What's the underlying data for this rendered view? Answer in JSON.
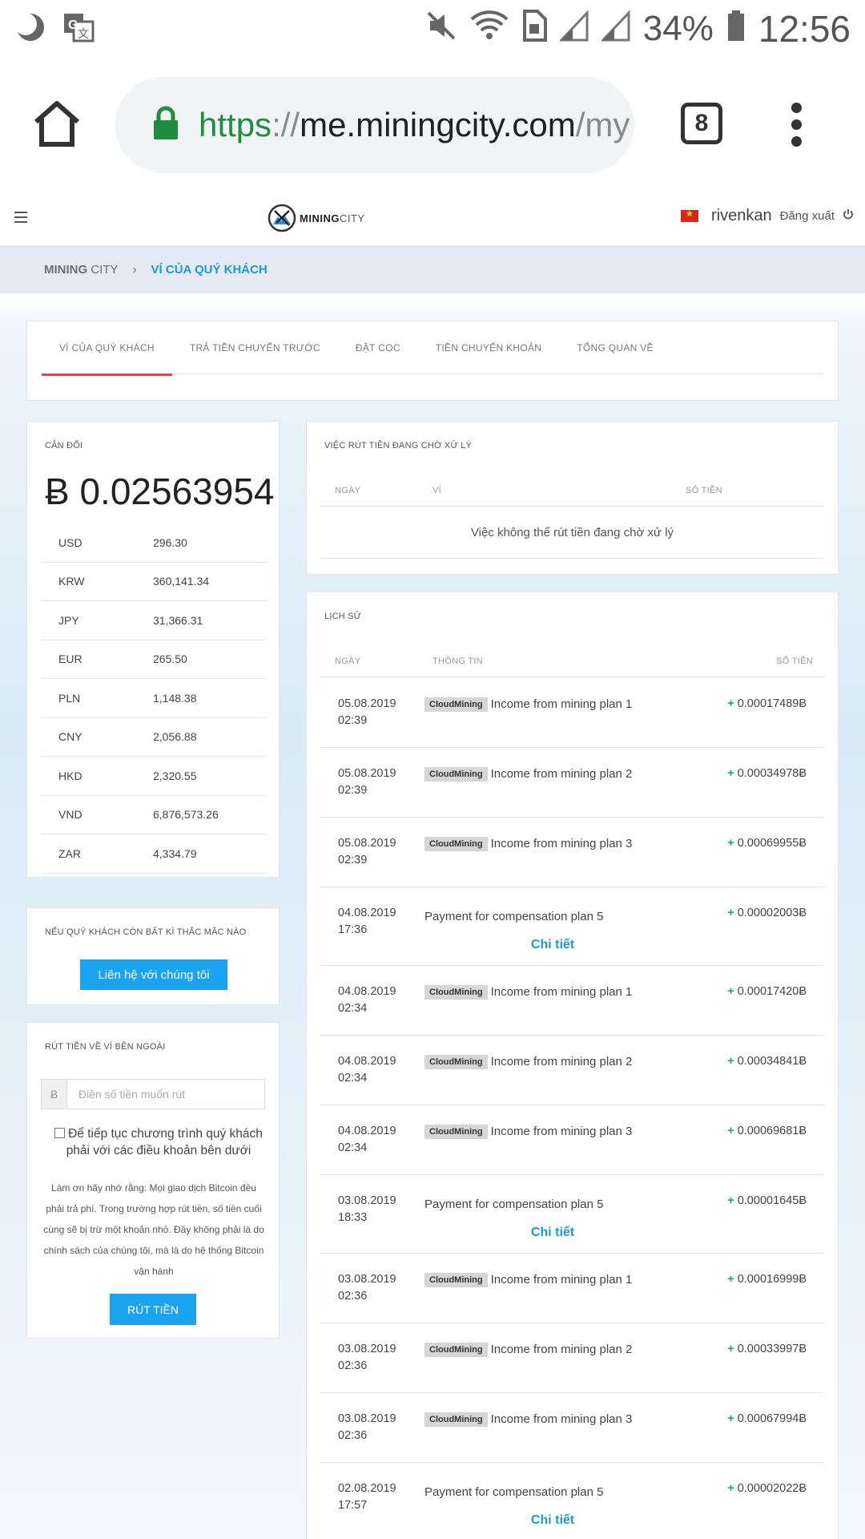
{
  "status_bar": {
    "battery": "34%",
    "time": "12:56",
    "icons": [
      "moon-icon",
      "translate-icon",
      "mute-icon",
      "wifi-icon",
      "sim-icon",
      "signal-icon",
      "signal-icon",
      "battery-icon"
    ]
  },
  "browser": {
    "url_scheme": "https",
    "url_sep": "://",
    "url_host": "me.miningcity.com",
    "url_path": "/my",
    "tab_count": "8"
  },
  "site": {
    "logo_main": "MINING",
    "logo_sub": "CITY",
    "username": "rivenkan",
    "logout": "Đăng xuất"
  },
  "breadcrumb": {
    "root_main": "MINING",
    "root_sub": " CITY",
    "sep": "›",
    "current": "VÍ CỦA QUÝ KHÁCH"
  },
  "tabs": [
    {
      "label": "VÍ CỦA QUÝ KHÁCH",
      "active": true
    },
    {
      "label": "TRẢ TIỀN CHUYỂN TRƯỚC",
      "active": false
    },
    {
      "label": "ĐẶT CỌC",
      "active": false
    },
    {
      "label": "TIỀN CHUYỂN KHOẢN",
      "active": false
    },
    {
      "label": "TỔNG QUAN VỀ",
      "active": false
    }
  ],
  "balance": {
    "label": "CÂN ĐỐI",
    "amount": "Ƀ 0.02563954",
    "currencies": [
      {
        "code": "USD",
        "value": "296.30"
      },
      {
        "code": "KRW",
        "value": "360,141.34"
      },
      {
        "code": "JPY",
        "value": "31,366.31"
      },
      {
        "code": "EUR",
        "value": "265.50"
      },
      {
        "code": "PLN",
        "value": "1,148.38"
      },
      {
        "code": "CNY",
        "value": "2,056.88"
      },
      {
        "code": "HKD",
        "value": "2,320.55"
      },
      {
        "code": "VND",
        "value": "6,876,573.26"
      },
      {
        "code": "ZAR",
        "value": "4,334.79"
      }
    ]
  },
  "help": {
    "label": "NẾU QUÝ KHÁCH CÒN BẤT KÌ THẮC MẮC NÀO",
    "button": "Liên hệ với chúng tôi"
  },
  "withdraw": {
    "label": "RÚT TIỀN VỀ VÍ BÊN NGOÀI",
    "prefix": "Ƀ",
    "placeholder": "Điền số tiền muốn rút",
    "checkbox_text": "Để tiếp tục chương trình quý khách phải với các điều khoản bên dưới",
    "note": "Làm ơn hãy nhớ rằng: Mọi giao dịch Bitcoin đều phải trả phí. Trong trường hợp rút tiền, số tiền cuối cùng sẽ bị trừ một khoản nhỏ. Đây không phải là do chính sách của chúng tôi, mà là do hệ thống Bitcoin vận hành",
    "button": "RÚT TIỀN"
  },
  "pending": {
    "label": "VIỆC RÚT TIỀN ĐANG CHỜ XỬ LÝ",
    "columns": [
      "NGÀY",
      "VÍ",
      "SỐ TIỀN"
    ],
    "empty": "Việc không thể rút tiền đang chờ xử lý"
  },
  "history": {
    "label": "LỊCH SỬ",
    "columns": [
      "NGÀY",
      "THÔNG TIN",
      "SỐ TIỀN"
    ],
    "detail_label": "Chi tiết",
    "rows": [
      {
        "date": "05.08.2019",
        "time": "02:39",
        "tag": "CloudMining",
        "info": "Income from mining plan 1",
        "amount": "0.00017489Ƀ",
        "detail": false
      },
      {
        "date": "05.08.2019",
        "time": "02:39",
        "tag": "CloudMining",
        "info": "Income from mining plan 2",
        "amount": "0.00034978Ƀ",
        "detail": false
      },
      {
        "date": "05.08.2019",
        "time": "02:39",
        "tag": "CloudMining",
        "info": "Income from mining plan 3",
        "amount": "0.00069955Ƀ",
        "detail": false
      },
      {
        "date": "04.08.2019",
        "time": "17:36",
        "tag": "",
        "info": "Payment for compensation plan 5",
        "amount": "0.00002003Ƀ",
        "detail": true
      },
      {
        "date": "04.08.2019",
        "time": "02:34",
        "tag": "CloudMining",
        "info": "Income from mining plan 1",
        "amount": "0.00017420Ƀ",
        "detail": false
      },
      {
        "date": "04.08.2019",
        "time": "02:34",
        "tag": "CloudMining",
        "info": "Income from mining plan 2",
        "amount": "0.00034841Ƀ",
        "detail": false
      },
      {
        "date": "04.08.2019",
        "time": "02:34",
        "tag": "CloudMining",
        "info": "Income from mining plan 3",
        "amount": "0.00069681Ƀ",
        "detail": false
      },
      {
        "date": "03.08.2019",
        "time": "18:33",
        "tag": "",
        "info": "Payment for compensation plan 5",
        "amount": "0.00001645Ƀ",
        "detail": true
      },
      {
        "date": "03.08.2019",
        "time": "02:36",
        "tag": "CloudMining",
        "info": "Income from mining plan 1",
        "amount": "0.00016999Ƀ",
        "detail": false
      },
      {
        "date": "03.08.2019",
        "time": "02:36",
        "tag": "CloudMining",
        "info": "Income from mining plan 2",
        "amount": "0.00033997Ƀ",
        "detail": false
      },
      {
        "date": "03.08.2019",
        "time": "02:36",
        "tag": "CloudMining",
        "info": "Income from mining plan 3",
        "amount": "0.00067994Ƀ",
        "detail": false
      },
      {
        "date": "02.08.2019",
        "time": "17:57",
        "tag": "",
        "info": "Payment for compensation plan 5",
        "amount": "0.00002022Ƀ",
        "detail": true
      }
    ]
  }
}
